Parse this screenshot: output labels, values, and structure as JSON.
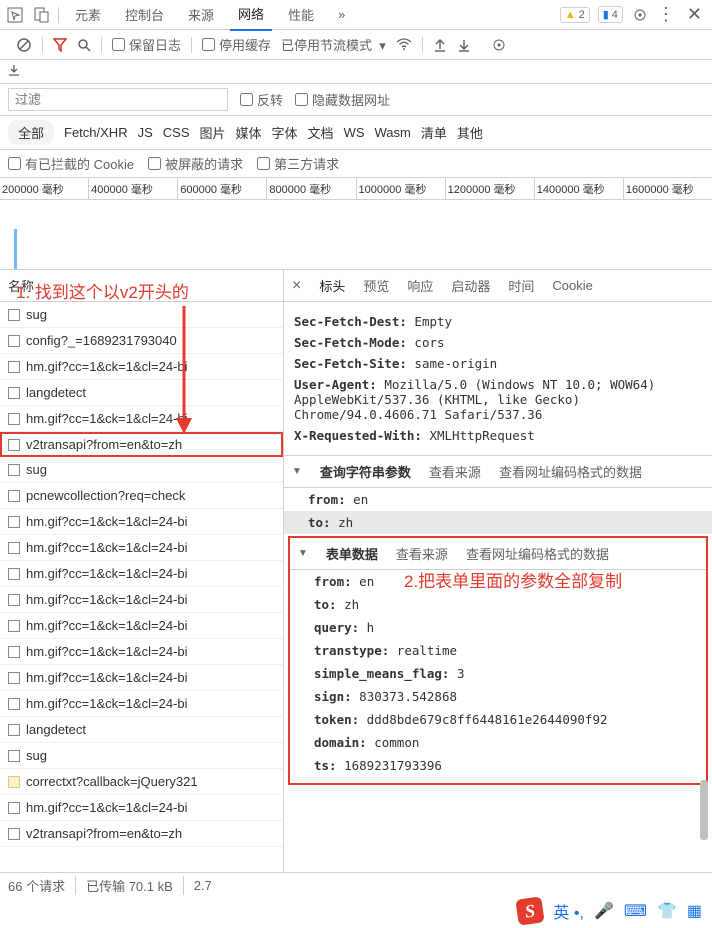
{
  "topTabs": {
    "elements": "元素",
    "console": "控制台",
    "sources": "来源",
    "network": "网络",
    "performance": "性能",
    "more": "»",
    "warnCount": "2",
    "msgCount": "4"
  },
  "toolbar": {
    "preserve": "保留日志",
    "disableCache": "停用缓存",
    "throttling": "已停用节流模式"
  },
  "filterRow": {
    "placeholder": "过滤",
    "invert": "反转",
    "hideData": "隐藏数据网址"
  },
  "types": {
    "all": "全部",
    "xhr": "Fetch/XHR",
    "js": "JS",
    "css": "CSS",
    "img": "图片",
    "media": "媒体",
    "font": "字体",
    "doc": "文档",
    "ws": "WS",
    "wasm": "Wasm",
    "manifest": "清单",
    "other": "其他"
  },
  "tags": {
    "blockedCookie": "有已拦截的 Cookie",
    "blockedReq": "被屏蔽的请求",
    "thirdParty": "第三方请求"
  },
  "timeline": [
    "200000 毫秒",
    "400000 毫秒",
    "600000 毫秒",
    "800000 毫秒",
    "1000000 毫秒",
    "1200000 毫秒",
    "1400000 毫秒",
    "1600000 毫秒"
  ],
  "leftHeader": "名称",
  "requests": [
    {
      "t": "doc",
      "n": "sug"
    },
    {
      "t": "doc",
      "n": "config?_=1689231793040"
    },
    {
      "t": "doc",
      "n": "hm.gif?cc=1&ck=1&cl=24-bi"
    },
    {
      "t": "doc",
      "n": "langdetect"
    },
    {
      "t": "doc",
      "n": "hm.gif?cc=1&ck=1&cl=24-bi"
    },
    {
      "t": "doc",
      "n": "v2transapi?from=en&to=zh",
      "sel": true
    },
    {
      "t": "doc",
      "n": "sug"
    },
    {
      "t": "doc",
      "n": "pcnewcollection?req=check"
    },
    {
      "t": "doc",
      "n": "hm.gif?cc=1&ck=1&cl=24-bi"
    },
    {
      "t": "doc",
      "n": "hm.gif?cc=1&ck=1&cl=24-bi"
    },
    {
      "t": "doc",
      "n": "hm.gif?cc=1&ck=1&cl=24-bi"
    },
    {
      "t": "doc",
      "n": "hm.gif?cc=1&ck=1&cl=24-bi"
    },
    {
      "t": "doc",
      "n": "hm.gif?cc=1&ck=1&cl=24-bi"
    },
    {
      "t": "doc",
      "n": "hm.gif?cc=1&ck=1&cl=24-bi"
    },
    {
      "t": "doc",
      "n": "hm.gif?cc=1&ck=1&cl=24-bi"
    },
    {
      "t": "doc",
      "n": "hm.gif?cc=1&ck=1&cl=24-bi"
    },
    {
      "t": "doc",
      "n": "langdetect"
    },
    {
      "t": "doc",
      "n": "sug"
    },
    {
      "t": "js",
      "n": "correctxt?callback=jQuery321"
    },
    {
      "t": "doc",
      "n": "hm.gif?cc=1&ck=1&cl=24-bi"
    },
    {
      "t": "doc",
      "n": "v2transapi?from=en&to=zh"
    }
  ],
  "rightTabs": {
    "close": "×",
    "headers": "标头",
    "preview": "预览",
    "response": "响应",
    "initiator": "启动器",
    "timing": "时间",
    "cookie": "Cookie"
  },
  "headersBlock": {
    "fetchDestPartial": "Empty",
    "fetchMode": {
      "k": "Sec-Fetch-Mode:",
      "v": "cors"
    },
    "fetchSite": {
      "k": "Sec-Fetch-Site:",
      "v": "same-origin"
    },
    "ua": {
      "k": "User-Agent:",
      "v": "Mozilla/5.0 (Windows NT 10.0; WOW64) AppleWebKit/537.36 (KHTML, like Gecko) Chrome/94.0.4606.71 Safari/537.36"
    },
    "xrw": {
      "k": "X-Requested-With:",
      "v": "XMLHttpRequest"
    }
  },
  "queryStr": {
    "title": "查询字符串参数",
    "viewSource": "查看来源",
    "viewEnc": "查看网址编码格式的数据",
    "from": {
      "k": "from:",
      "v": "en"
    },
    "to": {
      "k": "to:",
      "v": "zh"
    }
  },
  "formData": {
    "title": "表单数据",
    "viewSource": "查看来源",
    "viewEnc": "查看网址编码格式的数据",
    "items": [
      {
        "k": "from:",
        "v": "en"
      },
      {
        "k": "to:",
        "v": "zh"
      },
      {
        "k": "query:",
        "v": "h"
      },
      {
        "k": "transtype:",
        "v": "realtime"
      },
      {
        "k": "simple_means_flag:",
        "v": "3"
      },
      {
        "k": "sign:",
        "v": "830373.542868"
      },
      {
        "k": "token:",
        "v": "ddd8bde679c8ff6448161e2644090f92"
      },
      {
        "k": "domain:",
        "v": "common"
      },
      {
        "k": "ts:",
        "v": "1689231793396"
      }
    ]
  },
  "status": {
    "reqs": "66 个请求",
    "xfer": "已传输 70.1 kB",
    "res": "2.7"
  },
  "annotations": {
    "a1": "1. 找到这个以v2开头的",
    "a2": "2.把表单里面的参数全部复制"
  },
  "ime": {
    "s": "S",
    "lang": "英"
  }
}
